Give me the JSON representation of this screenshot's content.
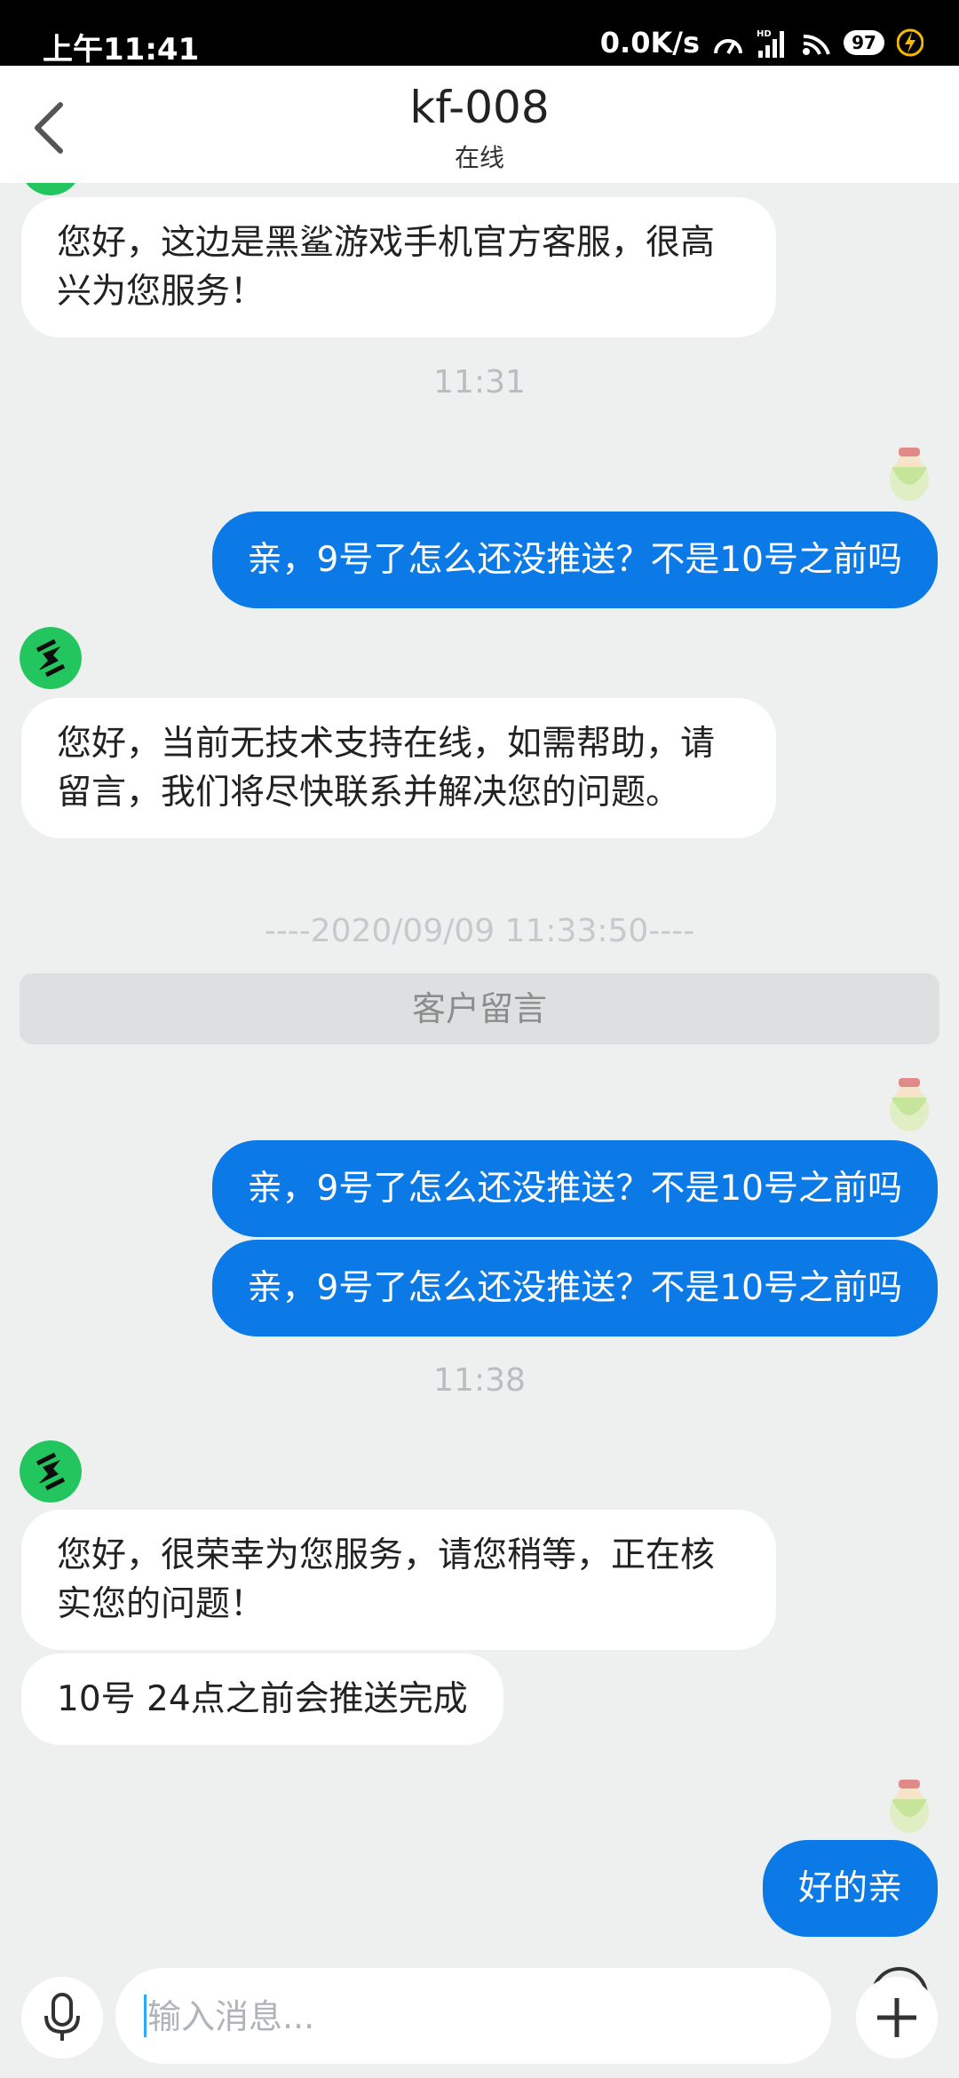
{
  "status_bar": {
    "time": "上午11:41",
    "speed": "0.0K/s",
    "battery": "97"
  },
  "header": {
    "title": "kf-008",
    "status": "在线"
  },
  "messages": {
    "m1": "您好，这边是黑鲨游戏手机官方客服，很高兴为您服务！",
    "ts1": "11:31",
    "m2": "亲，9号了怎么还没推送？不是10号之前吗",
    "m3": "您好，当前无技术支持在线，如需帮助，请留言，我们将尽快联系并解决您的问题。",
    "ts2": "----2020/09/09 11:33:50----",
    "leave_message": "客户留言",
    "m4": "亲，9号了怎么还没推送？不是10号之前吗",
    "m5": "亲，9号了怎么还没推送？不是10号之前吗",
    "ts3": "11:38",
    "m6": "您好，很荣幸为您服务，请您稍等，正在核实您的问题！",
    "m7": "10号 24点之前会推送完成",
    "m8": "好的亲"
  },
  "input": {
    "placeholder": "输入消息..."
  },
  "colors": {
    "accent": "#0b79e6",
    "bot_avatar": "#22c55e",
    "background": "#eef0f0"
  },
  "icons": [
    "back-icon",
    "signal-icon",
    "wifi-icon",
    "battery-icon",
    "charging-icon",
    "mic-icon",
    "emoji-icon",
    "plus-icon"
  ]
}
